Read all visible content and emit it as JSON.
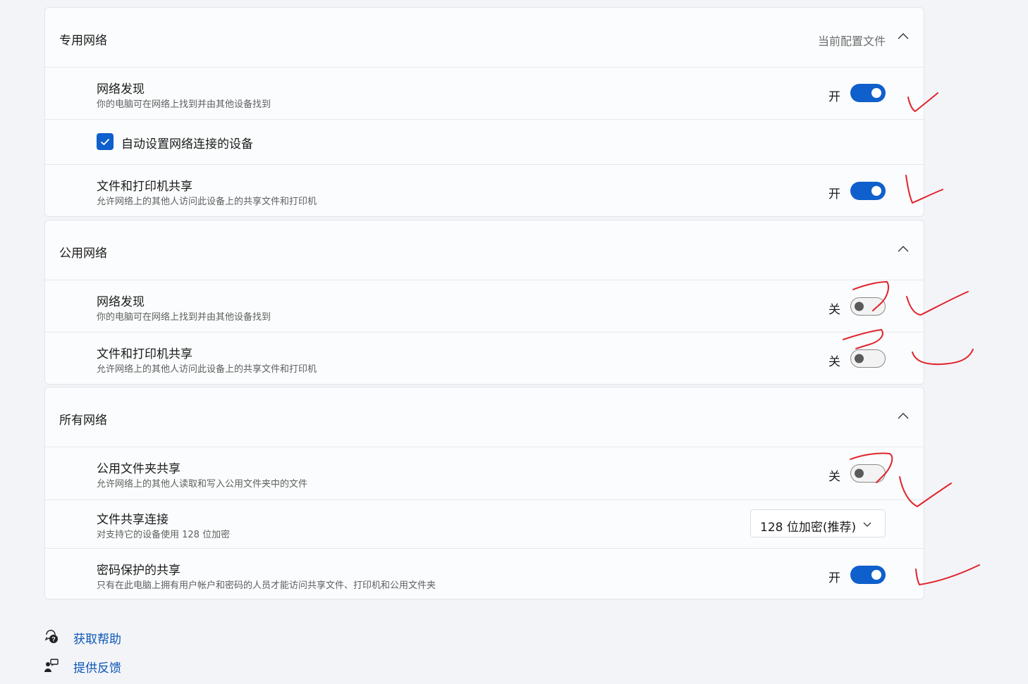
{
  "private_network": {
    "title": "专用网络",
    "profile_label": "当前配置文件",
    "network_discovery": {
      "title": "网络发现",
      "desc": "你的电脑可在网络上找到并由其他设备找到",
      "state": "开",
      "on": true
    },
    "auto_setup": {
      "label": "自动设置网络连接的设备",
      "checked": true
    },
    "file_printer_sharing": {
      "title": "文件和打印机共享",
      "desc": "允许网络上的其他人访问此设备上的共享文件和打印机",
      "state": "开",
      "on": true
    }
  },
  "public_network": {
    "title": "公用网络",
    "network_discovery": {
      "title": "网络发现",
      "desc": "你的电脑可在网络上找到并由其他设备找到",
      "state": "关",
      "on": false
    },
    "file_printer_sharing": {
      "title": "文件和打印机共享",
      "desc": "允许网络上的其他人访问此设备上的共享文件和打印机",
      "state": "关",
      "on": false
    }
  },
  "all_networks": {
    "title": "所有网络",
    "public_folder_sharing": {
      "title": "公用文件夹共享",
      "desc": "允许网络上的其他人读取和写入公用文件夹中的文件",
      "state": "关",
      "on": false
    },
    "file_sharing_connections": {
      "title": "文件共享连接",
      "desc": "对支持它的设备使用 128 位加密",
      "selected": "128 位加密(推荐)"
    },
    "password_protected_sharing": {
      "title": "密码保护的共享",
      "desc": "只有在此电脑上拥有用户帐户和密码的人员才能访问共享文件、打印机和公用文件夹",
      "state": "开",
      "on": true
    }
  },
  "footer": {
    "help": "获取帮助",
    "feedback": "提供反馈"
  },
  "colors": {
    "accent": "#0f5fcc",
    "annotation_ink": "#e0242b",
    "link": "#0b57b7"
  }
}
